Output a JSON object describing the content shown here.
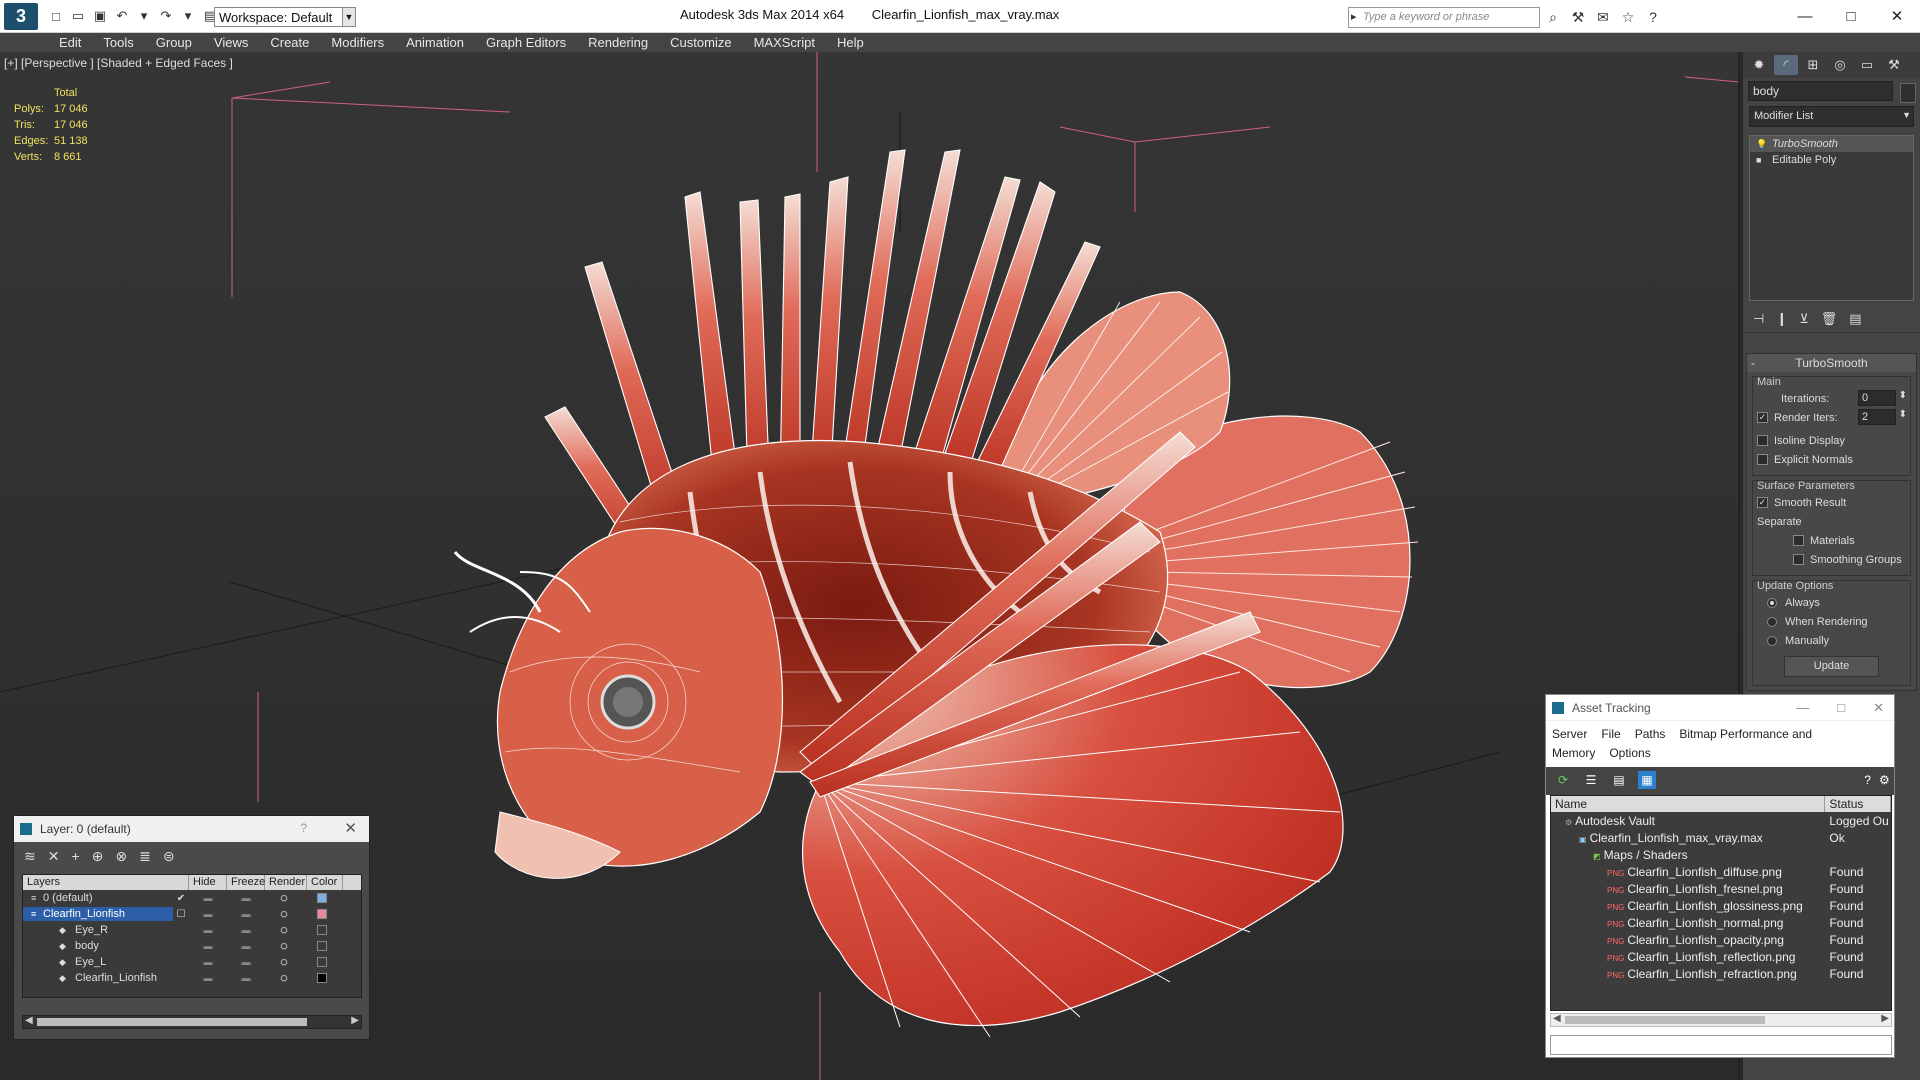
{
  "app": {
    "title": "Autodesk 3ds Max  2014 x64",
    "file": "Clearfin_Lionfish_max_vray.max",
    "workspace": "Workspace: Default",
    "search_placeholder": "Type a keyword or phrase"
  },
  "menu": [
    "Edit",
    "Tools",
    "Group",
    "Views",
    "Create",
    "Modifiers",
    "Animation",
    "Graph Editors",
    "Rendering",
    "Customize",
    "MAXScript",
    "Help"
  ],
  "viewport": {
    "label": "[+] [Perspective ] [Shaded + Edged Faces ]",
    "stats": {
      "header": "Total",
      "rows": [
        {
          "k": "Polys:",
          "v": "17 046"
        },
        {
          "k": "Tris:",
          "v": "17 046"
        },
        {
          "k": "Edges:",
          "v": "51 138"
        },
        {
          "k": "Verts:",
          "v": "8 661"
        }
      ]
    }
  },
  "command_panel": {
    "object_name": "body",
    "modifier_list": "Modifier List",
    "stack": [
      "TurboSmooth",
      "Editable Poly"
    ],
    "rollout": {
      "title": "TurboSmooth",
      "main": "Main",
      "iterations_label": "Iterations:",
      "iterations_value": "0",
      "render_iters_label": "Render Iters:",
      "render_iters_value": "2",
      "isoline": "Isoline Display",
      "explicit_normals": "Explicit Normals",
      "surface_params": "Surface Parameters",
      "smooth_result": "Smooth Result",
      "separate": "Separate",
      "materials": "Materials",
      "smoothing_groups": "Smoothing Groups",
      "update_options": "Update Options",
      "always": "Always",
      "when_rendering": "When Rendering",
      "manually": "Manually",
      "update": "Update"
    }
  },
  "layers": {
    "title": "Layer: 0 (default)",
    "headers": [
      "Layers",
      "Hide",
      "Freeze",
      "Render",
      "Color"
    ],
    "rows": [
      {
        "name": "0 (default)",
        "child": false,
        "active": true,
        "color": "#7ab0e0"
      },
      {
        "name": "Clearfin_Lionfish",
        "child": false,
        "selected": true,
        "color": "#e88aa0"
      },
      {
        "name": "Eye_R",
        "child": true,
        "color": "#3a3a3a"
      },
      {
        "name": "body",
        "child": true,
        "color": "#3a3a3a"
      },
      {
        "name": "Eye_L",
        "child": true,
        "color": "#3a3a3a"
      },
      {
        "name": "Clearfin_Lionfish",
        "child": true,
        "color": "#000000"
      }
    ]
  },
  "asset_tracking": {
    "title": "Asset Tracking",
    "menu": [
      "Server",
      "File",
      "Paths",
      "Bitmap Performance and Memory",
      "Options"
    ],
    "headers": [
      "Name",
      "Status"
    ],
    "rows": [
      {
        "name": "Autodesk Vault",
        "status": "Logged Ou",
        "indent": 1,
        "icon": "vault"
      },
      {
        "name": "Clearfin_Lionfish_max_vray.max",
        "status": "Ok",
        "indent": 2,
        "icon": "file"
      },
      {
        "name": "Maps / Shaders",
        "status": "",
        "indent": 3,
        "icon": "maps"
      },
      {
        "name": "Clearfin_Lionfish_diffuse.png",
        "status": "Found",
        "indent": 4,
        "icon": "png"
      },
      {
        "name": "Clearfin_Lionfish_fresnel.png",
        "status": "Found",
        "indent": 4,
        "icon": "png"
      },
      {
        "name": "Clearfin_Lionfish_glossiness.png",
        "status": "Found",
        "indent": 4,
        "icon": "png"
      },
      {
        "name": "Clearfin_Lionfish_normal.png",
        "status": "Found",
        "indent": 4,
        "icon": "png"
      },
      {
        "name": "Clearfin_Lionfish_opacity.png",
        "status": "Found",
        "indent": 4,
        "icon": "png"
      },
      {
        "name": "Clearfin_Lionfish_reflection.png",
        "status": "Found",
        "indent": 4,
        "icon": "png"
      },
      {
        "name": "Clearfin_Lionfish_refraction.png",
        "status": "Found",
        "indent": 4,
        "icon": "png"
      }
    ]
  }
}
